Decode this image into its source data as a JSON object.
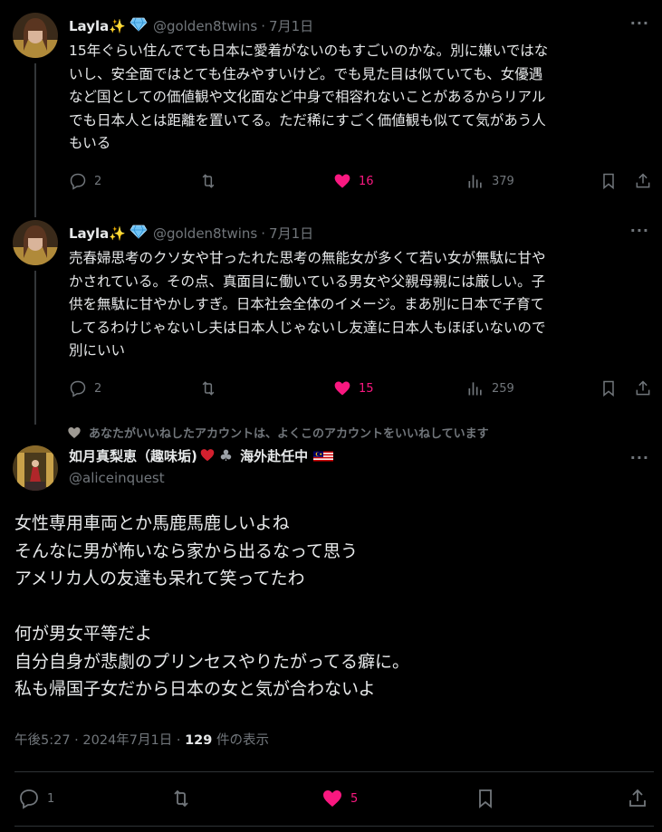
{
  "tweets": [
    {
      "display_name": "Layla✨",
      "handle": "@golden8twins",
      "sep": "·",
      "date": "7月1日",
      "more": "···",
      "lines": [
        "15年ぐらい住んでても日本に愛着がないのもすごいのかな。別に嫌いではな",
        "いし、安全面ではとても住みやすいけど。でも見た目は似ていても、女優遇",
        "など国としての価値観や文化面など中身で相容れないことがあるからリアル",
        "でも日本人とは距離を置いてる。ただ稀にすごく価値観も似てて気があう人",
        "もいる"
      ],
      "replies": "2",
      "likes": "16",
      "views": "379"
    },
    {
      "display_name": "Layla✨",
      "handle": "@golden8twins",
      "sep": "·",
      "date": "7月1日",
      "more": "···",
      "lines": [
        "売春婦思考のクソ女や甘ったれた思考の無能女が多くて若い女が無駄に甘や",
        "かされている。その点、真面目に働いている男女や父親母親には厳しい。子",
        "供を無駄に甘やかしすぎ。日本社会全体のイメージ。まあ別に日本で子育て",
        "してるわけじゃないし夫は日本人じゃないし友達に日本人もほぼいないので",
        "別にいい"
      ],
      "replies": "2",
      "likes": "15",
      "views": "259"
    }
  ],
  "social_context": "あなたがいいねしたアカウントは、よくこのアカウントをいいねしています",
  "main": {
    "display_name": "如月真梨恵（趣味垢)",
    "name_suffix": "海外赴任中",
    "handle": "@aliceinquest",
    "more": "···",
    "lines": [
      "女性専用車両とか馬鹿馬鹿しいよね",
      "そんなに男が怖いなら家から出るなって思う",
      "アメリカ人の友達も呆れて笑ってたわ",
      "",
      "何が男女平等だよ",
      "自分自身が悲劇のプリンセスやりたがってる癖に。",
      "私も帰国子女だから日本の女と気が合わないよ"
    ],
    "time": "午後5:27",
    "sep1": "·",
    "date": "2024年7月1日",
    "sep2": "·",
    "views": "129",
    "views_suffix": " 件の表示",
    "replies": "1",
    "likes": "5"
  },
  "colors": {
    "like": "#f91880",
    "muted": "#71767b",
    "verified": "#1d9bf0"
  }
}
